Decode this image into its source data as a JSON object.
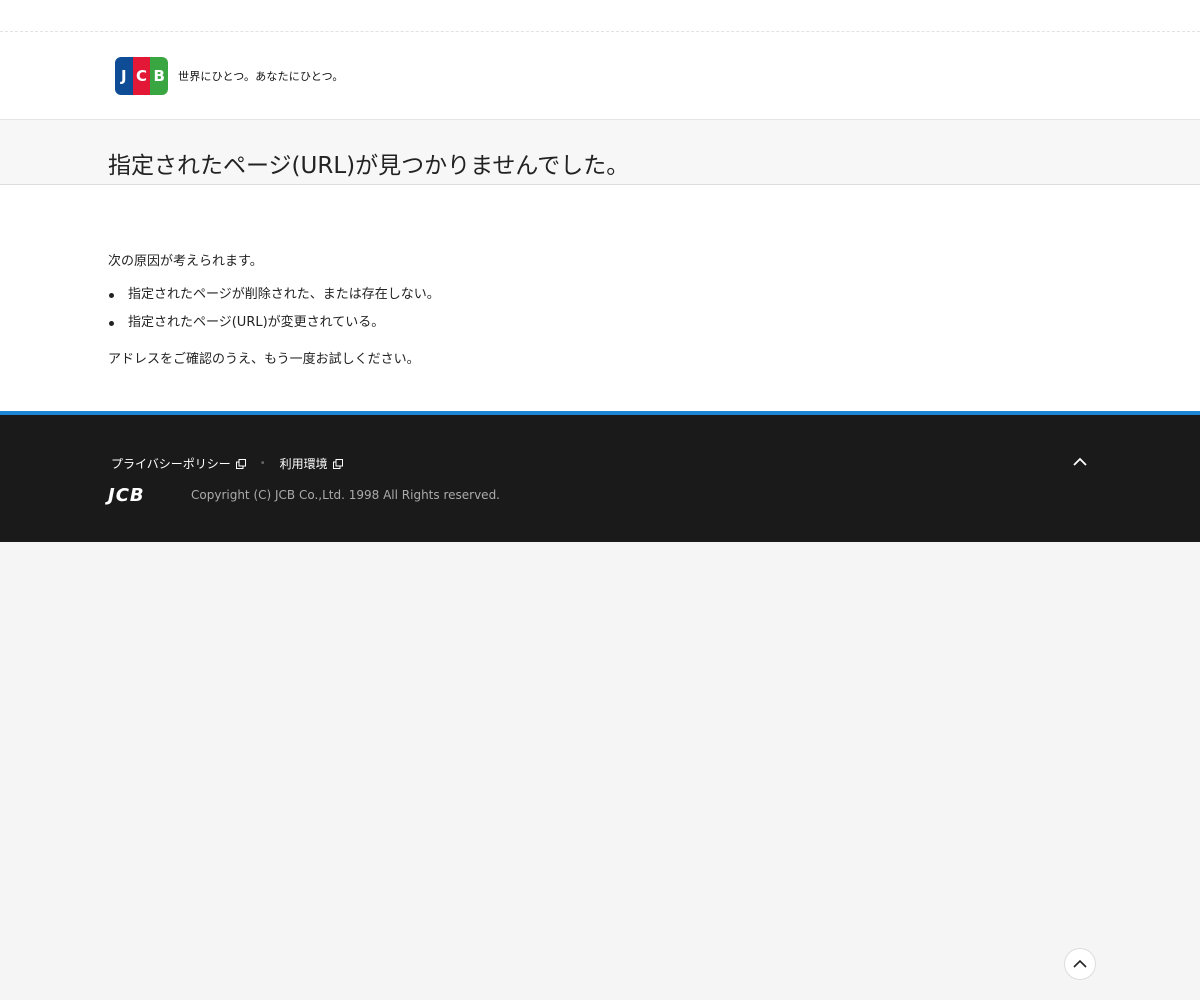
{
  "header": {
    "brand": "JCB",
    "brand_letters": [
      "J",
      "C",
      "B"
    ],
    "tagline": "世界にひとつ。あなたにひとつ。"
  },
  "page": {
    "title": "指定されたページ(URL)が見つかりませんでした。",
    "lead": "次の原因が考えられます。",
    "reasons": [
      "指定されたページが削除された、または存在しない。",
      "指定されたページ(URL)が変更されている。"
    ],
    "tail": "アドレスをご確認のうえ、もう一度お試しください。"
  },
  "footer": {
    "links": [
      {
        "label": "プライバシーポリシー",
        "icon": "external-link-icon"
      },
      {
        "label": "利用環境",
        "icon": "external-link-icon"
      }
    ],
    "separator": "•",
    "logo": "JCB",
    "copyright": "Copyright (C) JCB Co.,Ltd. 1998 All Rights reserved."
  },
  "colors": {
    "jcb_blue": "#0e4c96",
    "jcb_red": "#e21836",
    "jcb_green": "#3aa641",
    "footer_bg": "#1a1a1a",
    "footer_accent": "#1d87d5"
  },
  "icons": {
    "footer_top": "chevron-up-icon",
    "floating_top": "chevron-up-icon"
  }
}
